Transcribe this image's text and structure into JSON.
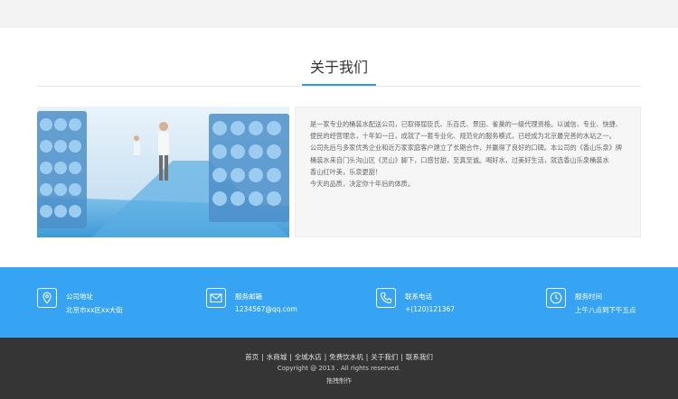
{
  "section": {
    "title": "关于我们"
  },
  "about": {
    "paragraphs": [
      "是一家专业的桶装水配送公司，已取得屈臣氏、乐百氏、景田、雀巢的一级代理资格。以诚信、专业、快捷、便民的经营理念，十年如一日，成就了一套专业化、规范化的服务模式，已经成为北京最完善的水站之一。",
      "公司先后与多家优秀企业和近万家家庭客户建立了长期合作，并赢得了良好的口碑。本公司的《香山乐泉》牌桶装水来自门头沟山区《灵山》脚下，口感甘甜，至真至诚。喝好水，过美好生活，就选香山乐泉桶装水",
      "香山红叶美，乐泉更甜！",
      "今天的品质，决定你十年后的体质。"
    ]
  },
  "info": [
    {
      "icon": "location-pin-icon",
      "label": "公司地址",
      "value": "北京市xx区xx大街"
    },
    {
      "icon": "mail-icon",
      "label": "服务邮箱",
      "value": "1234567@qq.com"
    },
    {
      "icon": "phone-icon",
      "label": "联系电话",
      "value": "+(120)121367"
    },
    {
      "icon": "clock-icon",
      "label": "服务时间",
      "value": "上午八点到下午五点"
    }
  ],
  "footer": {
    "links": [
      "首页",
      "水商城",
      "全城水店",
      "免费饮水机",
      "关于我们",
      "联系我们"
    ],
    "separator": "|",
    "copyright": "Copyright @ 2013 . All rights reserved.",
    "credit": "拖拽制作"
  },
  "colors": {
    "accent": "#36a4f2",
    "footer": "#353535",
    "underline": "#2e9bf0"
  }
}
